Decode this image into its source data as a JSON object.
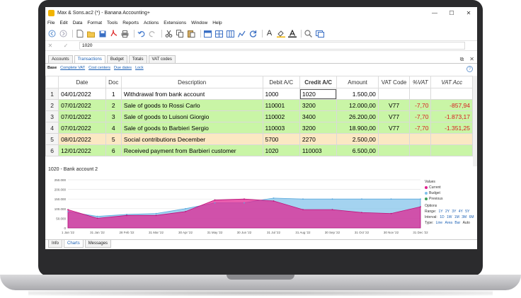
{
  "window": {
    "title": "Max & Sons.ac2 (*) - Banana Accounting+",
    "minimize": "—",
    "maximize": "☐",
    "close": "✕"
  },
  "menu": [
    "File",
    "Edit",
    "Data",
    "Format",
    "Tools",
    "Reports",
    "Actions",
    "Extensions",
    "Window",
    "Help"
  ],
  "toolbar_icons": [
    "back-icon",
    "forward-icon",
    "new-icon",
    "open-icon",
    "save-icon",
    "pdf-icon",
    "print-icon",
    "undo-icon",
    "redo-icon",
    "cut-icon",
    "copy-icon",
    "paste-icon",
    "table-icon",
    "table-settings-icon",
    "columns-icon",
    "chart-icon",
    "refresh-icon",
    "font-icon",
    "fill-color-icon",
    "text-color-icon",
    "search-icon",
    "window-icon"
  ],
  "formula": {
    "value": "1020"
  },
  "tabs": [
    "Accounts",
    "Transactions",
    "Budget",
    "Totals",
    "VAT codes"
  ],
  "active_tab": "Transactions",
  "views": [
    "Base",
    "Complete VAT",
    "Cost centers",
    "Due dates",
    "Lock"
  ],
  "columns": [
    "Date",
    "Doc",
    "Description",
    "Debit A/C",
    "Credit A/C",
    "Amount",
    "VAT Code",
    "%VAT",
    "VAT Acc"
  ],
  "rows": [
    {
      "n": "1",
      "date": "04/01/2022",
      "doc": "1",
      "desc": "Withdrawal from bank account",
      "debit": "1000",
      "credit": "1020",
      "amount": "1.500,00",
      "vat": "",
      "pvat": "",
      "vatacc": "",
      "style": "r1"
    },
    {
      "n": "2",
      "date": "07/01/2022",
      "doc": "2",
      "desc": "Sale of goods to Rossi Carlo",
      "debit": "110001",
      "credit": "3200",
      "amount": "12.000,00",
      "vat": "V77",
      "pvat": "-7,70",
      "vatacc": "-857,94",
      "style": "green"
    },
    {
      "n": "3",
      "date": "07/01/2022",
      "doc": "3",
      "desc": "Sale of goods to Luisoni Giorgio",
      "debit": "110002",
      "credit": "3400",
      "amount": "26.200,00",
      "vat": "V77",
      "pvat": "-7,70",
      "vatacc": "-1.873,17",
      "style": "green"
    },
    {
      "n": "4",
      "date": "07/01/2022",
      "doc": "4",
      "desc": "Sale of goods to Barbieri Sergio",
      "debit": "110003",
      "credit": "3200",
      "amount": "18.900,00",
      "vat": "V77",
      "pvat": "-7,70",
      "vatacc": "-1.351,25",
      "style": "green"
    },
    {
      "n": "5",
      "date": "08/01/2022",
      "doc": "5",
      "desc": "Social contributions December",
      "debit": "5700",
      "credit": "2270",
      "amount": "2.500,00",
      "vat": "",
      "pvat": "",
      "vatacc": "",
      "style": "beige"
    },
    {
      "n": "6",
      "date": "12/01/2022",
      "doc": "6",
      "desc": "Received payment from Barbieri customer",
      "debit": "1020",
      "credit": "110003",
      "amount": "6.500,00",
      "vat": "",
      "pvat": "",
      "vatacc": "",
      "style": "green"
    }
  ],
  "chart_title": "1020 - Bank account 2",
  "legend": {
    "values_label": "Values",
    "current": "Current",
    "budget": "Budget",
    "previous": "Previous",
    "options_label": "Options",
    "range_label": "Range:",
    "range_opts": [
      "1Y",
      "2Y",
      "3Y",
      "4Y",
      "5Y"
    ],
    "interval_label": "Interval:",
    "interval_opts": [
      "1D",
      "1W",
      "1M",
      "3M",
      "6M"
    ],
    "type_label": "Type:",
    "type_opts": [
      "Line",
      "Area",
      "Bar",
      "Auto"
    ]
  },
  "colors": {
    "current": "#e01f8f",
    "budget": "#7ec0ea",
    "previous": "#3fa15b"
  },
  "chart_data": {
    "type": "area",
    "title": "1020 - Bank account 2",
    "x": [
      "1 Jan '22",
      "1 Feb '22",
      "1 Mar '22",
      "1 Apr '22",
      "1 May '22",
      "1 Jun '22",
      "1 Jul '22",
      "1 Aug '22",
      "1 Sep '22",
      "1 Oct '22",
      "1 Nov '22",
      "1 Dec '22",
      "31 Dec '22"
    ],
    "x_ticks": [
      "1 Jan '22",
      "31 Jan '22",
      "28 Feb '22",
      "31 Mar '22",
      "30 Apr '22",
      "31 May '22",
      "30 Jun '22",
      "31 Jul '22",
      "31 Aug '22",
      "30 Sep '22",
      "31 Oct '22",
      "30 Nov '22",
      "31 Dec '22"
    ],
    "y_ticks": [
      "0",
      "50.000",
      "100.000",
      "150.000",
      "200.000",
      "250.000"
    ],
    "ylim": [
      0,
      250000
    ],
    "series": [
      {
        "name": "Budget",
        "values": [
          85000,
          60000,
          70000,
          75000,
          100000,
          130000,
          130000,
          155000,
          150000,
          150000,
          150000,
          150000,
          150000
        ]
      },
      {
        "name": "Current",
        "values": [
          95000,
          50000,
          65000,
          65000,
          85000,
          145000,
          150000,
          140000,
          95000,
          95000,
          80000,
          75000,
          110000
        ]
      }
    ],
    "grid": true
  }
}
